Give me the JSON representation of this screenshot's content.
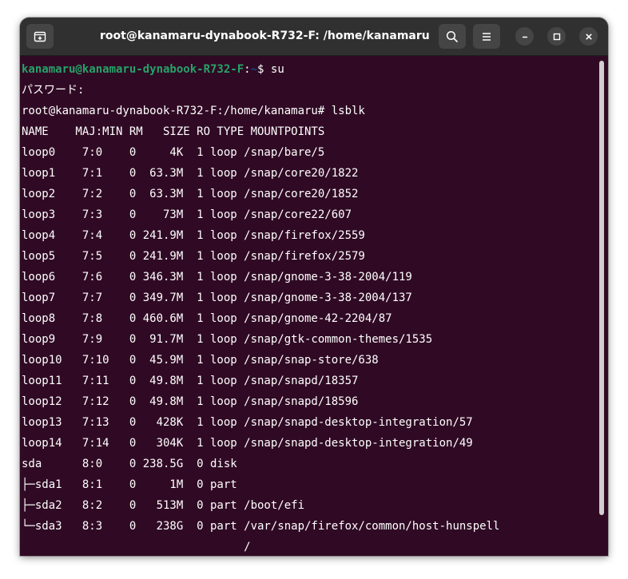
{
  "window": {
    "title": "root@kanamaru-dynabook-R732-F: /home/kanamaru"
  },
  "prompt": {
    "user_host": "kanamaru@kanamaru-dynabook-R732-F",
    "sep": ":",
    "path": "~",
    "symbol": "$ ",
    "command": "su"
  },
  "password_line": "パスワード:",
  "root_prompt": "root@kanamaru-dynabook-R732-F:/home/kanamaru# lsblk",
  "header": "NAME    MAJ:MIN RM   SIZE RO TYPE MOUNTPOINTS",
  "rows": [
    "loop0    7:0    0     4K  1 loop /snap/bare/5",
    "loop1    7:1    0  63.3M  1 loop /snap/core20/1822",
    "loop2    7:2    0  63.3M  1 loop /snap/core20/1852",
    "loop3    7:3    0    73M  1 loop /snap/core22/607",
    "loop4    7:4    0 241.9M  1 loop /snap/firefox/2559",
    "loop5    7:5    0 241.9M  1 loop /snap/firefox/2579",
    "loop6    7:6    0 346.3M  1 loop /snap/gnome-3-38-2004/119",
    "loop7    7:7    0 349.7M  1 loop /snap/gnome-3-38-2004/137",
    "loop8    7:8    0 460.6M  1 loop /snap/gnome-42-2204/87",
    "loop9    7:9    0  91.7M  1 loop /snap/gtk-common-themes/1535",
    "loop10   7:10   0  45.9M  1 loop /snap/snap-store/638",
    "loop11   7:11   0  49.8M  1 loop /snap/snapd/18357",
    "loop12   7:12   0  49.8M  1 loop /snap/snapd/18596",
    "loop13   7:13   0   428K  1 loop /snap/snapd-desktop-integration/57",
    "loop14   7:14   0   304K  1 loop /snap/snapd-desktop-integration/49",
    "sda      8:0    0 238.5G  0 disk ",
    "├─sda1   8:1    0     1M  0 part ",
    "├─sda2   8:2    0   513M  0 part /boot/efi",
    "└─sda3   8:3    0   238G  0 part /var/snap/firefox/common/host-hunspell",
    "                                 /"
  ],
  "icons": {
    "new_tab": "new-tab-icon",
    "search": "search-icon",
    "menu": "hamburger-menu-icon",
    "minimize": "minimize-icon",
    "maximize": "maximize-icon",
    "close": "close-icon"
  },
  "colors": {
    "terminal_bg": "#300a24",
    "titlebar_bg": "#303030",
    "user_host": "#26a269",
    "path": "#12488b"
  }
}
